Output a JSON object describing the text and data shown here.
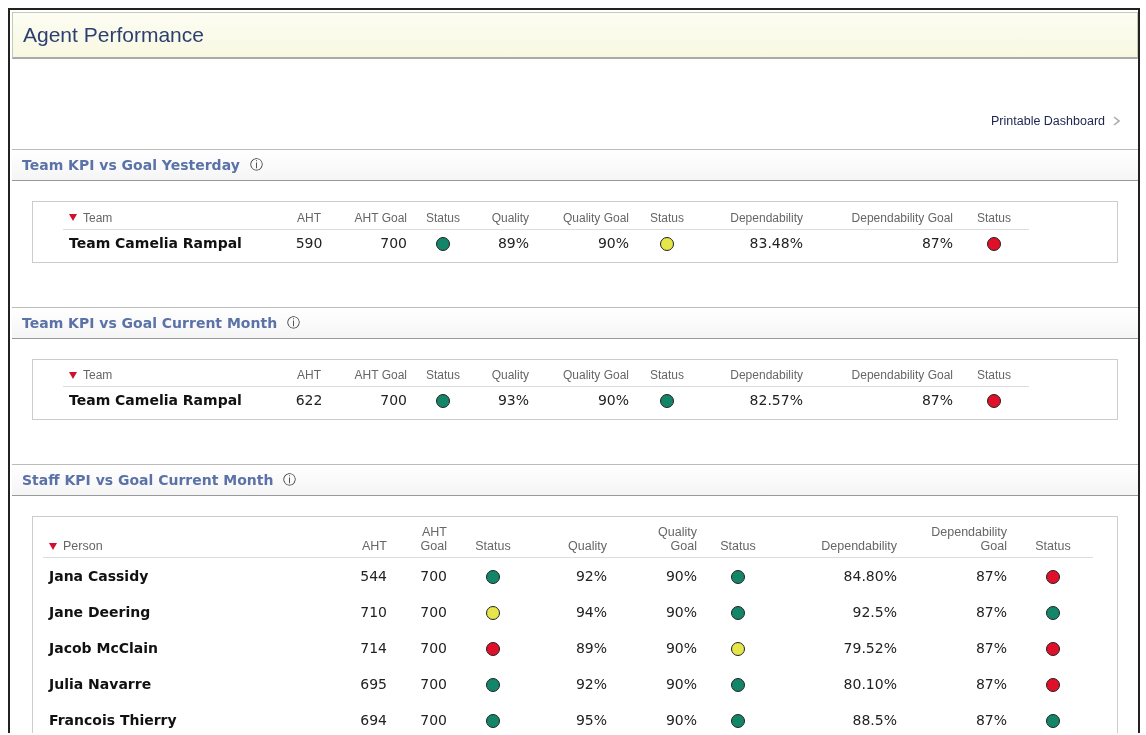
{
  "title": "Agent Performance",
  "printable_link": "Printable Dashboard",
  "sections": [
    {
      "kind": "team",
      "title": "Team KPI vs Goal Yesterday",
      "info": "ⓘ",
      "columns": [
        {
          "label": "Team",
          "sorted": true
        },
        {
          "label": "AHT",
          "sorted": false
        },
        {
          "label": "AHT Goal",
          "sorted": false
        },
        {
          "label": "Status",
          "sorted": false
        },
        {
          "label": "Quality",
          "sorted": false
        },
        {
          "label": "Quality Goal",
          "sorted": false
        },
        {
          "label": "Status",
          "sorted": false
        },
        {
          "label": "Dependability",
          "sorted": false
        },
        {
          "label": "Dependability Goal",
          "sorted": false
        },
        {
          "label": "Status",
          "sorted": false
        }
      ],
      "rows": [
        {
          "cells": [
            {
              "kind": "text",
              "text": "Team Camelia Rampal"
            },
            {
              "kind": "text",
              "text": "590"
            },
            {
              "kind": "text",
              "text": "700"
            },
            {
              "kind": "status",
              "color": "#13866a"
            },
            {
              "kind": "text",
              "text": "89%"
            },
            {
              "kind": "text",
              "text": "90%"
            },
            {
              "kind": "status",
              "color": "#e6e64a"
            },
            {
              "kind": "text",
              "text": "83.48%"
            },
            {
              "kind": "text",
              "text": "87%"
            },
            {
              "kind": "status",
              "color": "#e0102a"
            }
          ]
        }
      ]
    },
    {
      "kind": "team",
      "title": "Team KPI vs Goal Current Month",
      "info": "ⓘ",
      "columns": [
        {
          "label": "Team",
          "sorted": true
        },
        {
          "label": "AHT",
          "sorted": false
        },
        {
          "label": "AHT Goal",
          "sorted": false
        },
        {
          "label": "Status",
          "sorted": false
        },
        {
          "label": "Quality",
          "sorted": false
        },
        {
          "label": "Quality Goal",
          "sorted": false
        },
        {
          "label": "Status",
          "sorted": false
        },
        {
          "label": "Dependability",
          "sorted": false
        },
        {
          "label": "Dependability Goal",
          "sorted": false
        },
        {
          "label": "Status",
          "sorted": false
        }
      ],
      "rows": [
        {
          "cells": [
            {
              "kind": "text",
              "text": "Team Camelia Rampal"
            },
            {
              "kind": "text",
              "text": "622"
            },
            {
              "kind": "text",
              "text": "700"
            },
            {
              "kind": "status",
              "color": "#13866a"
            },
            {
              "kind": "text",
              "text": "93%"
            },
            {
              "kind": "text",
              "text": "90%"
            },
            {
              "kind": "status",
              "color": "#13866a"
            },
            {
              "kind": "text",
              "text": "82.57%"
            },
            {
              "kind": "text",
              "text": "87%"
            },
            {
              "kind": "status",
              "color": "#e0102a"
            }
          ]
        }
      ]
    },
    {
      "kind": "staff",
      "title": "Staff KPI vs Goal Current Month",
      "info": "ⓘ",
      "columns": [
        {
          "label": "Person",
          "sorted": true
        },
        {
          "label": "AHT",
          "sorted": false
        },
        {
          "label": "AHT Goal",
          "sorted": false
        },
        {
          "label": "Status",
          "sorted": false
        },
        {
          "label": "Quality",
          "sorted": false
        },
        {
          "label": "Quality Goal",
          "sorted": false
        },
        {
          "label": "Status",
          "sorted": false
        },
        {
          "label": "Dependability",
          "sorted": false
        },
        {
          "label": "Dependability Goal",
          "sorted": false
        },
        {
          "label": "Status",
          "sorted": false
        }
      ],
      "rows": [
        {
          "cells": [
            {
              "kind": "text",
              "text": "Jana Cassidy"
            },
            {
              "kind": "text",
              "text": "544"
            },
            {
              "kind": "text",
              "text": "700"
            },
            {
              "kind": "status",
              "color": "#13866a"
            },
            {
              "kind": "text",
              "text": "92%"
            },
            {
              "kind": "text",
              "text": "90%"
            },
            {
              "kind": "status",
              "color": "#13866a"
            },
            {
              "kind": "text",
              "text": "84.80%"
            },
            {
              "kind": "text",
              "text": "87%"
            },
            {
              "kind": "status",
              "color": "#e0102a"
            }
          ]
        },
        {
          "cells": [
            {
              "kind": "text",
              "text": "Jane Deering"
            },
            {
              "kind": "text",
              "text": "710"
            },
            {
              "kind": "text",
              "text": "700"
            },
            {
              "kind": "status",
              "color": "#e6e64a"
            },
            {
              "kind": "text",
              "text": "94%"
            },
            {
              "kind": "text",
              "text": "90%"
            },
            {
              "kind": "status",
              "color": "#13866a"
            },
            {
              "kind": "text",
              "text": "92.5%"
            },
            {
              "kind": "text",
              "text": "87%"
            },
            {
              "kind": "status",
              "color": "#13866a"
            }
          ]
        },
        {
          "cells": [
            {
              "kind": "text",
              "text": "Jacob McClain"
            },
            {
              "kind": "text",
              "text": "714"
            },
            {
              "kind": "text",
              "text": "700"
            },
            {
              "kind": "status",
              "color": "#e0102a"
            },
            {
              "kind": "text",
              "text": "89%"
            },
            {
              "kind": "text",
              "text": "90%"
            },
            {
              "kind": "status",
              "color": "#e6e64a"
            },
            {
              "kind": "text",
              "text": "79.52%"
            },
            {
              "kind": "text",
              "text": "87%"
            },
            {
              "kind": "status",
              "color": "#e0102a"
            }
          ]
        },
        {
          "cells": [
            {
              "kind": "text",
              "text": "Julia Navarre"
            },
            {
              "kind": "text",
              "text": "695"
            },
            {
              "kind": "text",
              "text": "700"
            },
            {
              "kind": "status",
              "color": "#13866a"
            },
            {
              "kind": "text",
              "text": "92%"
            },
            {
              "kind": "text",
              "text": "90%"
            },
            {
              "kind": "status",
              "color": "#13866a"
            },
            {
              "kind": "text",
              "text": "80.10%"
            },
            {
              "kind": "text",
              "text": "87%"
            },
            {
              "kind": "status",
              "color": "#e0102a"
            }
          ]
        },
        {
          "cells": [
            {
              "kind": "text",
              "text": "Francois Thierry"
            },
            {
              "kind": "text",
              "text": "694"
            },
            {
              "kind": "text",
              "text": "700"
            },
            {
              "kind": "status",
              "color": "#13866a"
            },
            {
              "kind": "text",
              "text": "95%"
            },
            {
              "kind": "text",
              "text": "90%"
            },
            {
              "kind": "status",
              "color": "#13866a"
            },
            {
              "kind": "text",
              "text": "88.5%"
            },
            {
              "kind": "text",
              "text": "87%"
            },
            {
              "kind": "status",
              "color": "#13866a"
            }
          ]
        }
      ]
    }
  ]
}
